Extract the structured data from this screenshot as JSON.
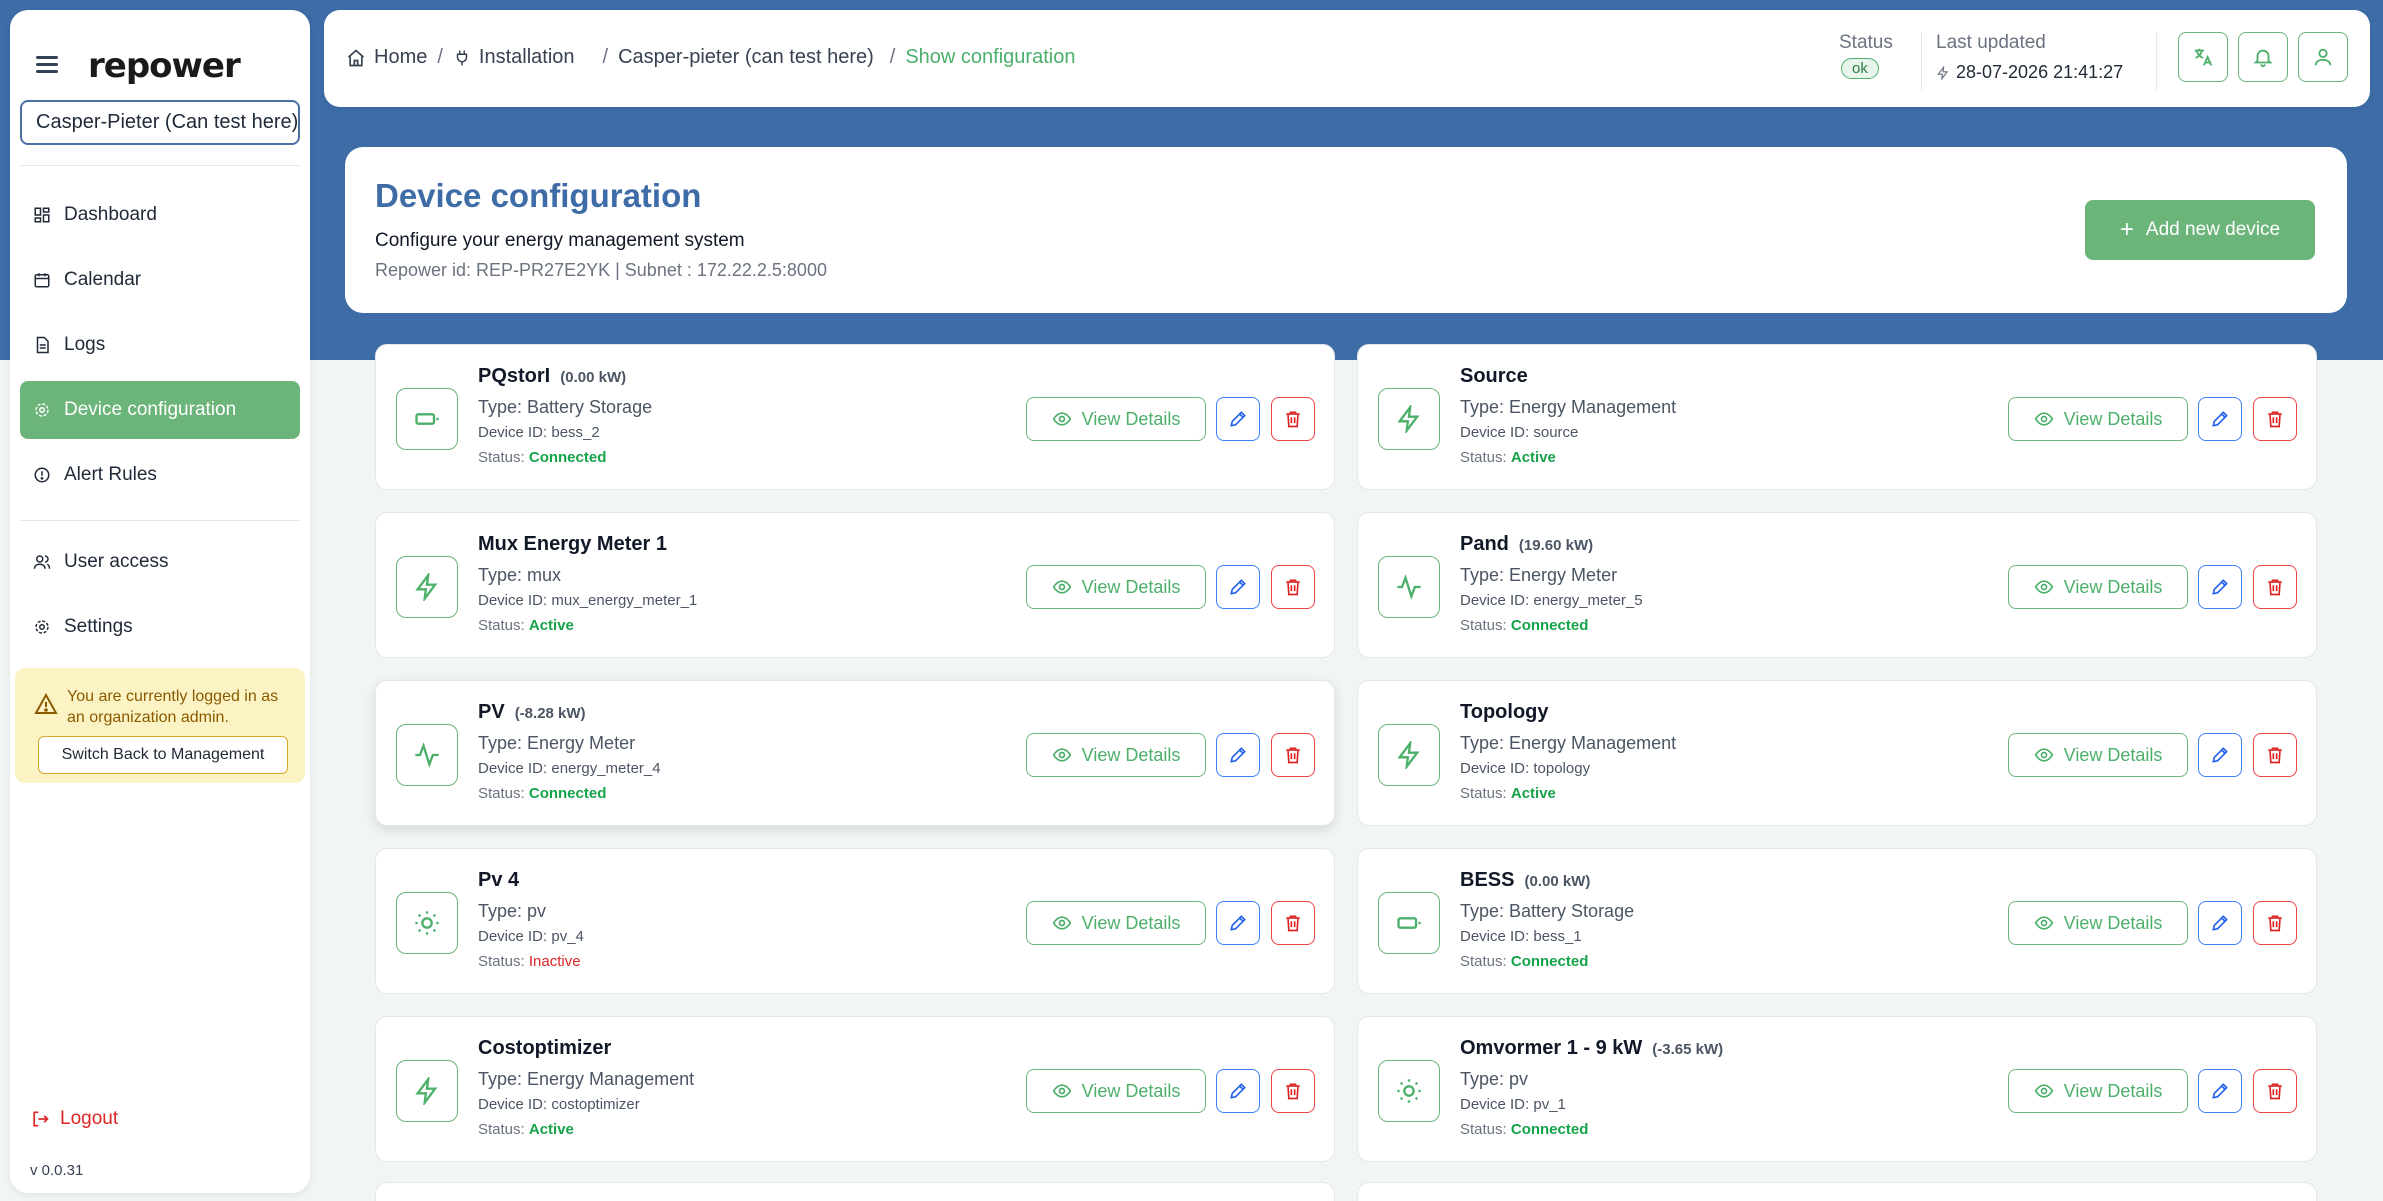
{
  "app": {
    "logo": "repower",
    "version": "v 0.0.31"
  },
  "sidebar": {
    "installation_value": "Casper-Pieter (Can test here)",
    "items": [
      {
        "label": "Dashboard",
        "icon": "dashboard-icon"
      },
      {
        "label": "Calendar",
        "icon": "calendar-icon"
      },
      {
        "label": "Logs",
        "icon": "logs-icon"
      },
      {
        "label": "Device configuration",
        "icon": "gear-icon"
      },
      {
        "label": "Alert Rules",
        "icon": "alert-icon"
      },
      {
        "label": "User access",
        "icon": "users-icon"
      },
      {
        "label": "Settings",
        "icon": "settings-icon"
      }
    ],
    "admin_notice": "You are currently logged in as an organization admin.",
    "switch_label": "Switch Back to Management",
    "logout_label": "Logout"
  },
  "header": {
    "breadcrumbs": [
      "Home",
      "Installation",
      "Casper-pieter (can test here)",
      "Show configuration"
    ],
    "status_label": "Status",
    "status_value": "ok",
    "updated_label": "Last updated",
    "updated_value": "28-07-2026 21:41:27"
  },
  "page": {
    "title": "Device configuration",
    "subtitle": "Configure your energy management system",
    "repower_id_line": "Repower id: REP-PR27E2YK | Subnet : 172.22.2.5:8000",
    "add_label": "Add new device"
  },
  "devices": [
    {
      "name": "PQstorI",
      "power": "(0.00 kW)",
      "type": "Type: Battery Storage",
      "device_id": "Device ID: bess_2",
      "status_prefix": "Status: ",
      "status": "Connected",
      "icon": "battery-icon"
    },
    {
      "name": "Source",
      "power": "",
      "type": "Type: Energy Management",
      "device_id": "Device ID: source",
      "status_prefix": "Status: ",
      "status": "Active",
      "icon": "bolt-icon"
    },
    {
      "name": "Mux Energy Meter 1",
      "power": "",
      "type": "Type: mux",
      "device_id": "Device ID: mux_energy_meter_1",
      "status_prefix": "Status: ",
      "status": "Active",
      "icon": "bolt-icon"
    },
    {
      "name": "Pand",
      "power": "(19.60 kW)",
      "type": "Type: Energy Meter",
      "device_id": "Device ID: energy_meter_5",
      "status_prefix": "Status: ",
      "status": "Connected",
      "icon": "pulse-icon"
    },
    {
      "name": "PV",
      "power": "(-8.28 kW)",
      "type": "Type: Energy Meter",
      "device_id": "Device ID: energy_meter_4",
      "status_prefix": "Status: ",
      "status": "Connected",
      "icon": "pulse-icon"
    },
    {
      "name": "Topology",
      "power": "",
      "type": "Type: Energy Management",
      "device_id": "Device ID: topology",
      "status_prefix": "Status: ",
      "status": "Active",
      "icon": "bolt-icon"
    },
    {
      "name": "Pv 4",
      "power": "",
      "type": "Type: pv",
      "device_id": "Device ID: pv_4",
      "status_prefix": "Status: ",
      "status": "Inactive",
      "icon": "sun-icon"
    },
    {
      "name": "BESS",
      "power": "(0.00 kW)",
      "type": "Type: Battery Storage",
      "device_id": "Device ID: bess_1",
      "status_prefix": "Status: ",
      "status": "Connected",
      "icon": "battery-icon"
    },
    {
      "name": "Costoptimizer",
      "power": "",
      "type": "Type: Energy Management",
      "device_id": "Device ID: costoptimizer",
      "status_prefix": "Status: ",
      "status": "Active",
      "icon": "bolt-icon"
    },
    {
      "name": "Omvormer 1 - 9 kW",
      "power": "(-3.65 kW)",
      "type": "Type: pv",
      "device_id": "Device ID: pv_1",
      "status_prefix": "Status: ",
      "status": "Connected",
      "icon": "sun-icon"
    }
  ],
  "card_actions": {
    "view_label": "View Details"
  },
  "colors": {
    "brand_blue": "#3d6ca7",
    "accent_green": "#6bb47a",
    "danger_red": "#dc2626",
    "edit_blue": "#2563eb"
  }
}
